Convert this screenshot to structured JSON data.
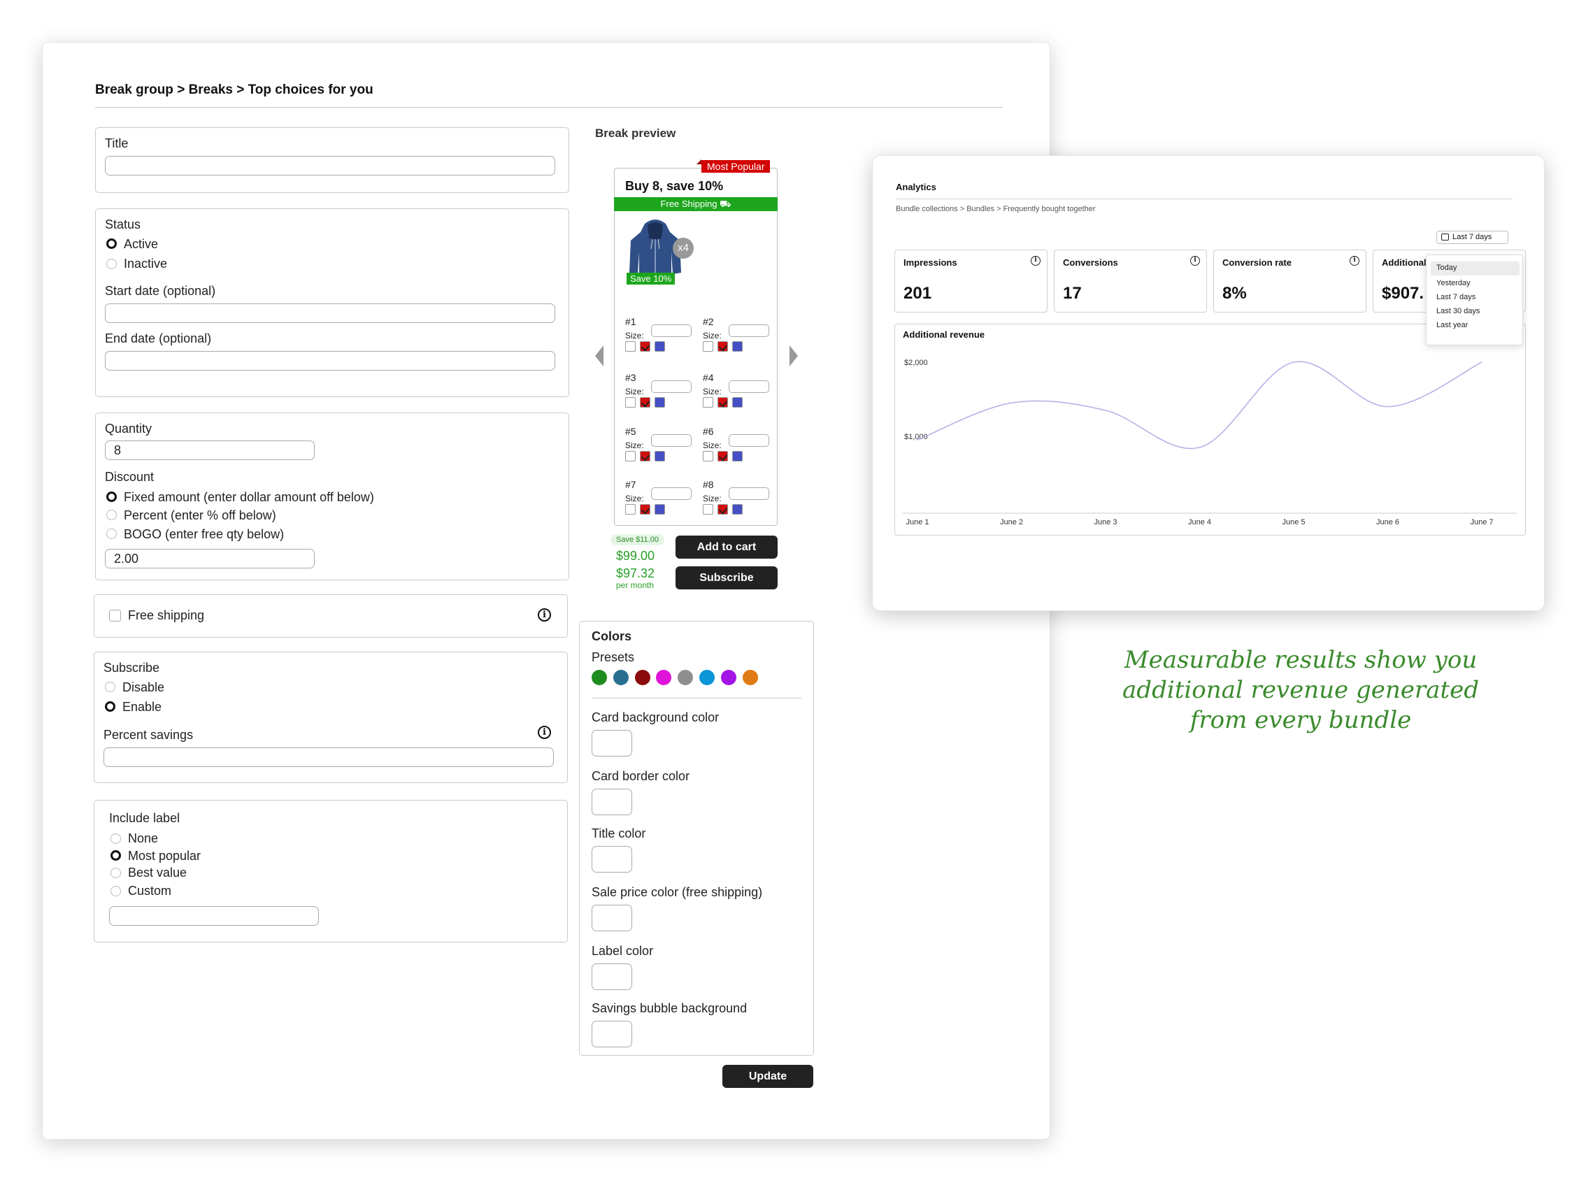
{
  "breadcrumb": "Break group > Breaks > Top choices for you",
  "form": {
    "title_label": "Title",
    "title_value": "",
    "status_label": "Status",
    "status_options": [
      "Active",
      "Inactive"
    ],
    "start_date_label": "Start date (optional)",
    "end_date_label": "End date (optional)",
    "quantity_label": "Quantity",
    "quantity_value": "8",
    "discount_label": "Discount",
    "discount_options": [
      "Fixed amount (enter dollar amount off below)",
      "Percent (enter % off below)",
      "BOGO (enter free qty below)"
    ],
    "discount_value": "2.00",
    "free_shipping_label": "Free shipping",
    "subscribe_label": "Subscribe",
    "subscribe_options": [
      "Disable",
      "Enable"
    ],
    "percent_savings_label": "Percent savings",
    "include_label_label": "Include label",
    "include_label_options": [
      "None",
      "Most popular",
      "Best value",
      "Custom"
    ]
  },
  "preview": {
    "heading": "Break preview",
    "badge": "Most Popular",
    "card_title": "Buy 8, save 10%",
    "free_shipping": "Free Shipping ⛟",
    "qty_badge": "x4",
    "save_badge": "Save 10%",
    "size_label": "Size:",
    "slots": [
      "#1",
      "#2",
      "#3",
      "#4",
      "#5",
      "#6",
      "#7",
      "#8"
    ],
    "savings_bubble": "Save $11.00",
    "price": "$99.00",
    "sub_price": "$97.32",
    "per_month": "per month",
    "add_to_cart": "Add to cart",
    "subscribe": "Subscribe"
  },
  "colors": {
    "heading": "Colors",
    "presets_label": "Presets",
    "presets": [
      "#1e8c1e",
      "#2a6f91",
      "#8a0c0c",
      "#e014d8",
      "#8e8e8e",
      "#0c96d8",
      "#a314e6",
      "#e07a14"
    ],
    "fields": [
      "Card background color",
      "Card border color",
      "Title color",
      "Sale price color (free shipping)",
      "Label color",
      "Savings bubble background"
    ],
    "update": "Update"
  },
  "analytics": {
    "title": "Analytics",
    "breadcrumb": "Bundle collections > Bundles > Frequently bought together",
    "date_button": "Last 7 days",
    "metrics": [
      {
        "name": "Impressions",
        "value": "201"
      },
      {
        "name": "Conversions",
        "value": "17"
      },
      {
        "name": "Conversion rate",
        "value": "8%"
      },
      {
        "name": "Additional",
        "value": "$907."
      }
    ],
    "dropdown": [
      "Today",
      "Yesterday",
      "Last 7 days",
      "Last 30 days",
      "Last year"
    ],
    "chart_title": "Additional revenue"
  },
  "chart_data": {
    "type": "line",
    "title": "Additional revenue",
    "categories": [
      "June 1",
      "June 2",
      "June 3",
      "June 4",
      "June 5",
      "June 6",
      "June 7"
    ],
    "y_ticks": [
      "$2,000",
      "$1,000"
    ],
    "ylim": [
      0,
      2000
    ],
    "series": [
      {
        "values": [
          950,
          1450,
          1350,
          850,
          2000,
          1400,
          2000
        ]
      }
    ],
    "line_color": "#b3b3e8"
  },
  "tagline": [
    "Measurable results show you",
    "additional revenue generated",
    "from every bundle"
  ]
}
